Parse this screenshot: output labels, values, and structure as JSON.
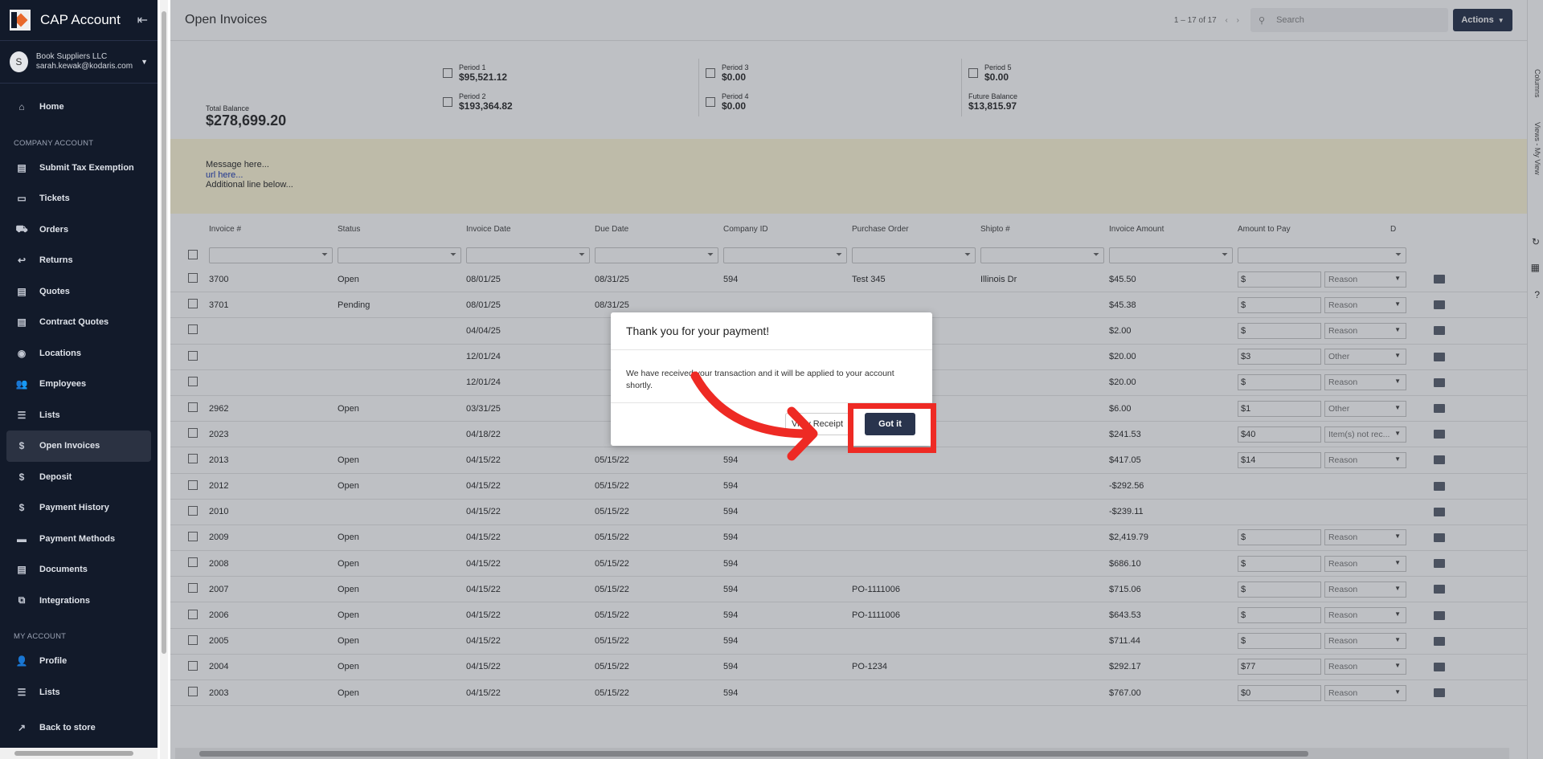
{
  "sidebar": {
    "title": "CAP Account",
    "user": {
      "initial": "S",
      "company": "Book Suppliers LLC",
      "email": "sarah.kewak@kodaris.com"
    },
    "home": "Home",
    "company_section": "COMPANY ACCOUNT",
    "company_items": [
      {
        "label": "Submit Tax Exemption",
        "icon": "document-icon"
      },
      {
        "label": "Tickets",
        "icon": "ticket-icon"
      },
      {
        "label": "Orders",
        "icon": "truck-icon"
      },
      {
        "label": "Returns",
        "icon": "return-icon"
      },
      {
        "label": "Quotes",
        "icon": "clipboard-icon"
      },
      {
        "label": "Contract Quotes",
        "icon": "clipboard-icon"
      },
      {
        "label": "Locations",
        "icon": "location-pin-icon"
      },
      {
        "label": "Employees",
        "icon": "people-icon"
      },
      {
        "label": "Lists",
        "icon": "list-icon"
      },
      {
        "label": "Open Invoices",
        "icon": "dollar-icon",
        "active": true
      },
      {
        "label": "Deposit",
        "icon": "dollar-icon"
      },
      {
        "label": "Payment History",
        "icon": "dollar-icon"
      },
      {
        "label": "Payment Methods",
        "icon": "credit-card-icon"
      },
      {
        "label": "Documents",
        "icon": "document-icon"
      },
      {
        "label": "Integrations",
        "icon": "integration-icon"
      }
    ],
    "my_section": "MY ACCOUNT",
    "my_items": [
      {
        "label": "Profile",
        "icon": "person-icon"
      },
      {
        "label": "Lists",
        "icon": "list-icon"
      }
    ],
    "back": "Back to store"
  },
  "header": {
    "title": "Open Invoices",
    "pager": "1 – 17 of 17",
    "search_placeholder": "Search",
    "actions_label": "Actions"
  },
  "balance": {
    "total_label": "Total Balance",
    "total_value": "$278,699.20",
    "periods": [
      {
        "label": "Period 1",
        "value": "$95,521.12"
      },
      {
        "label": "Period 2",
        "value": "$193,364.82"
      },
      {
        "label": "Period 3",
        "value": "$0.00"
      },
      {
        "label": "Period 4",
        "value": "$0.00"
      },
      {
        "label": "Period 5",
        "value": "$0.00"
      }
    ],
    "future_label": "Future Balance",
    "future_value": "$13,815.97"
  },
  "message": {
    "line1": "Message here...",
    "url": "url here...",
    "line3": "Additional line below..."
  },
  "table": {
    "columns": [
      "Invoice #",
      "Status",
      "Invoice Date",
      "Due Date",
      "Company ID",
      "Purchase Order",
      "Shipto #",
      "Invoice Amount",
      "Amount to Pay",
      "D"
    ],
    "rows": [
      {
        "inv": "3700",
        "status": "Open",
        "idate": "08/01/25",
        "due": "08/31/25",
        "cid": "594",
        "po": "Test 345",
        "ship": "Illinois Dr",
        "amt": "$45.50",
        "pay": "",
        "reason": "Reason"
      },
      {
        "inv": "3701",
        "status": "Pending",
        "idate": "08/01/25",
        "due": "08/31/25",
        "cid": "",
        "po": "",
        "ship": "",
        "amt": "$45.38",
        "pay": "",
        "reason": "Reason"
      },
      {
        "inv": "",
        "status": "",
        "idate": "04/04/25",
        "due": "",
        "cid": "",
        "po": "",
        "ship": "",
        "amt": "$2.00",
        "pay": "",
        "reason": "Reason"
      },
      {
        "inv": "",
        "status": "",
        "idate": "12/01/24",
        "due": "",
        "cid": "",
        "po": "",
        "ship": "",
        "amt": "$20.00",
        "pay": "3",
        "reason": "Other"
      },
      {
        "inv": "",
        "status": "",
        "idate": "12/01/24",
        "due": "",
        "cid": "",
        "po": "",
        "ship": "",
        "amt": "$20.00",
        "pay": "",
        "reason": "Reason"
      },
      {
        "inv": "2962",
        "status": "Open",
        "idate": "03/31/25",
        "due": "",
        "cid": "",
        "po": "",
        "ship": "",
        "amt": "$6.00",
        "pay": "1",
        "reason": "Other"
      },
      {
        "inv": "2023",
        "status": "",
        "idate": "04/18/22",
        "due": "",
        "cid": "",
        "po": "",
        "ship": "",
        "amt": "$241.53",
        "pay": "40",
        "reason": "Item(s) not rec..."
      },
      {
        "inv": "2013",
        "status": "Open",
        "idate": "04/15/22",
        "due": "05/15/22",
        "cid": "594",
        "po": "",
        "ship": "",
        "amt": "$417.05",
        "pay": "14",
        "reason": "Reason"
      },
      {
        "inv": "2012",
        "status": "Open",
        "idate": "04/15/22",
        "due": "05/15/22",
        "cid": "594",
        "po": "",
        "ship": "",
        "amt": "-$292.56",
        "pay": null,
        "reason": null
      },
      {
        "inv": "2010",
        "status": "",
        "idate": "04/15/22",
        "due": "05/15/22",
        "cid": "594",
        "po": "",
        "ship": "",
        "amt": "-$239.11",
        "pay": null,
        "reason": null
      },
      {
        "inv": "2009",
        "status": "Open",
        "idate": "04/15/22",
        "due": "05/15/22",
        "cid": "594",
        "po": "",
        "ship": "",
        "amt": "$2,419.79",
        "pay": "",
        "reason": "Reason"
      },
      {
        "inv": "2008",
        "status": "Open",
        "idate": "04/15/22",
        "due": "05/15/22",
        "cid": "594",
        "po": "",
        "ship": "",
        "amt": "$686.10",
        "pay": "",
        "reason": "Reason"
      },
      {
        "inv": "2007",
        "status": "Open",
        "idate": "04/15/22",
        "due": "05/15/22",
        "cid": "594",
        "po": "PO-1111006",
        "ship": "",
        "amt": "$715.06",
        "pay": "",
        "reason": "Reason"
      },
      {
        "inv": "2006",
        "status": "Open",
        "idate": "04/15/22",
        "due": "05/15/22",
        "cid": "594",
        "po": "PO-1111006",
        "ship": "",
        "amt": "$643.53",
        "pay": "",
        "reason": "Reason"
      },
      {
        "inv": "2005",
        "status": "Open",
        "idate": "04/15/22",
        "due": "05/15/22",
        "cid": "594",
        "po": "",
        "ship": "",
        "amt": "$711.44",
        "pay": "",
        "reason": "Reason"
      },
      {
        "inv": "2004",
        "status": "Open",
        "idate": "04/15/22",
        "due": "05/15/22",
        "cid": "594",
        "po": "PO-1234",
        "ship": "",
        "amt": "$292.17",
        "pay": "77",
        "reason": "Reason"
      },
      {
        "inv": "2003",
        "status": "Open",
        "idate": "04/15/22",
        "due": "05/15/22",
        "cid": "594",
        "po": "",
        "ship": "",
        "amt": "$767.00",
        "pay": "0",
        "reason": "Reason"
      }
    ]
  },
  "rail": {
    "columns": "Columns",
    "views": "Views - My View"
  },
  "modal": {
    "title": "Thank you for your payment!",
    "body": "We have received your transaction and it will be applied to your account shortly.",
    "view_receipt": "View Receipt",
    "got_it": "Got it"
  },
  "colors": {
    "sidebar_bg": "#121a2a",
    "primary_btn": "#29344d",
    "highlight": "#ee2a24",
    "message_bg": "#fff8d9"
  }
}
